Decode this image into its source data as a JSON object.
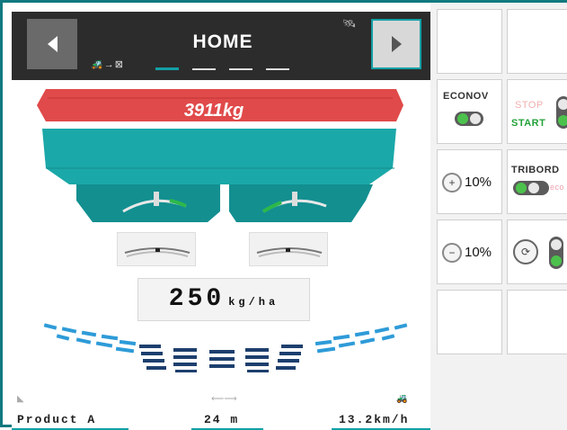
{
  "header": {
    "title": "HOME",
    "prev_icon": "arrow-left-icon",
    "next_icon": "arrow-right-icon",
    "page_indicator": {
      "count": 4,
      "active": 1
    }
  },
  "hopper": {
    "weight": "3911kg"
  },
  "rate": {
    "value": "250",
    "unit": "kg/ha"
  },
  "footer": {
    "product": "Product A",
    "width": "24 m",
    "speed": "13.2km/h"
  },
  "controls": {
    "econov_label": "ECONOV",
    "stop_label": "STOP",
    "start_label": "START",
    "left_pct": "10%",
    "tribord_label": "TRIBORD",
    "eco_label": "eco",
    "right_pct": "10%"
  },
  "colors": {
    "accent": "#13a0a6",
    "hopper_top": "#e04a4a",
    "hopper_body": "#1ba8a8",
    "spread_dark": "#1d3f6e",
    "spread_light": "#2e9bd8"
  }
}
